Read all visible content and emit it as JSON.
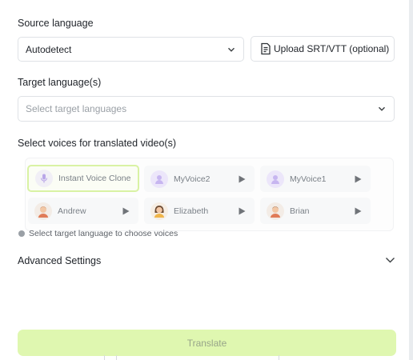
{
  "source": {
    "label": "Source language",
    "value": "Autodetect",
    "upload_label": "Upload SRT/VTT (optional)"
  },
  "target": {
    "label": "Target language(s)",
    "placeholder": "Select target languages"
  },
  "voices": {
    "label": "Select voices for translated video(s)",
    "items": [
      {
        "name": "Instant Voice Clone",
        "avatar": "clone-mic-icon",
        "selected": true
      },
      {
        "name": "MyVoice2",
        "avatar": "user-voice-icon",
        "playable": true
      },
      {
        "name": "MyVoice1",
        "avatar": "user-voice-icon",
        "playable": true
      },
      {
        "name": "Andrew",
        "avatar": "male-avatar",
        "playable": true
      },
      {
        "name": "Elizabeth",
        "avatar": "female-avatar",
        "playable": true
      },
      {
        "name": "Brian",
        "avatar": "male-avatar",
        "playable": true
      }
    ],
    "hint": "Select target language to choose voices"
  },
  "advanced": {
    "label": "Advanced Settings"
  },
  "actions": {
    "translate_label": "Translate"
  },
  "colors": {
    "accent": "#dff7b0",
    "selected_border": "#d9f2a4",
    "purple": "#c7b6f0"
  }
}
